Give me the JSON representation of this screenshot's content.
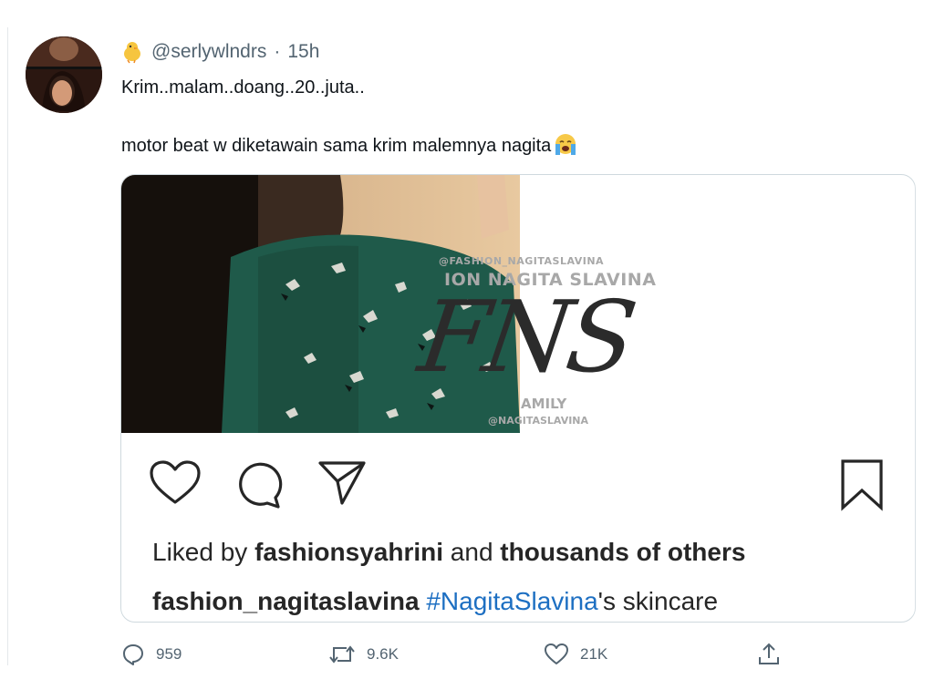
{
  "tweet": {
    "handle": "@serlywlndrs",
    "separator": "·",
    "time": "15h",
    "line1": "Krim..malam..doang..20..juta..",
    "line2": "motor beat w diketawain sama krim malemnya nagita",
    "badge_icon": "chick-icon",
    "emoji_icon": "loudly-crying-face-icon"
  },
  "embed": {
    "watermark": {
      "line1": "@FASHION_NAGITASLAVINA",
      "line2": "ION NAGITA SLAVINA",
      "logo": "FNS",
      "line3": "AMILY",
      "line4": "@NAGITASLAVINA"
    },
    "actions": [
      "heart-icon",
      "comment-icon",
      "share-icon",
      "bookmark-icon"
    ],
    "likes_prefix": "Liked by ",
    "likes_user": "fashionsyahrini",
    "likes_middle": " and ",
    "likes_rest": "thousands of others",
    "caption_user": "fashion_nagitaslavina",
    "caption_hashtag": "#NagitaSlavina",
    "caption_rest": "'s skincare"
  },
  "metrics": {
    "replies": "959",
    "retweets": "9.6K",
    "likes": "21K"
  },
  "colors": {
    "muted": "#536471",
    "hashtag": "#1d6fc2",
    "border": "#cfd9de"
  }
}
